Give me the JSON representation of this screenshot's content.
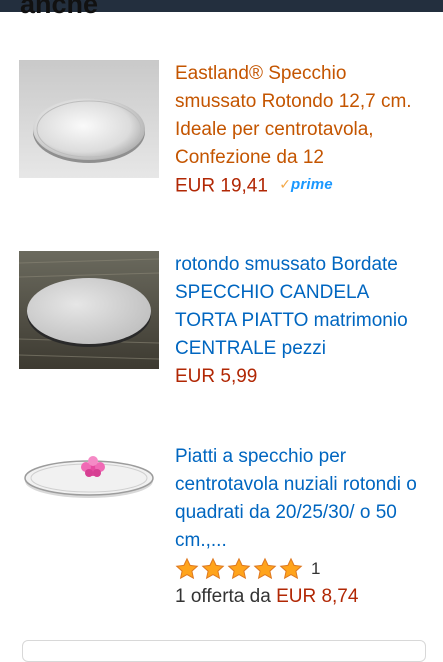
{
  "section": {
    "heading": "anche"
  },
  "products": [
    {
      "title": "Eastland® Specchio smussato Rotondo 12,7 cm. Ideale per centrotavola, Confezione da 12",
      "price": "EUR 19,41",
      "prime_label": "prime",
      "colors": {
        "title": "#c45500",
        "price": "#b12704"
      }
    },
    {
      "title": "rotondo smussato Bordate SPECCHIO CANDELA TORTA PIATTO matrimonio CENTRALE pezzi",
      "price": "EUR 5,99",
      "colors": {
        "title": "#0066c0",
        "price": "#b12704"
      }
    },
    {
      "title": "Piatti a specchio per centrotavola nuziali rotondi o quadrati da 20/25/30/ o 50 cm.,...",
      "rating": {
        "stars": 5,
        "count": "1"
      },
      "offer_prefix": "1 offerta da",
      "offer_price": "EUR 8,74",
      "colors": {
        "title": "#0066c0",
        "price": "#b12704",
        "star": "#ffa41c"
      }
    }
  ]
}
